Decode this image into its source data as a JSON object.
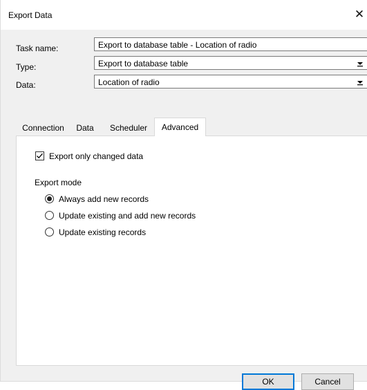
{
  "window": {
    "title": "Export Data",
    "close_glyph": "✕"
  },
  "form": {
    "task_name_label": "Task name:",
    "task_name_value": "Export to database table - Location of radio",
    "type_label": "Type:",
    "type_value": "Export to database table",
    "data_label": "Data:",
    "data_value": "Location of radio"
  },
  "tabs": [
    {
      "label": "Connection",
      "active": false
    },
    {
      "label": "Data",
      "active": false
    },
    {
      "label": "Scheduler",
      "active": false
    },
    {
      "label": "Advanced",
      "active": true
    }
  ],
  "advanced": {
    "export_changed_label": "Export only changed data",
    "export_changed_checked": true,
    "export_mode_label": "Export mode",
    "modes": [
      {
        "label": "Always add new records",
        "selected": true
      },
      {
        "label": "Update existing and add new records",
        "selected": false
      },
      {
        "label": "Update existing records",
        "selected": false
      }
    ]
  },
  "buttons": {
    "ok_label": "OK",
    "cancel_label": "Cancel"
  },
  "colors": {
    "accent": "#0078d7",
    "dialog_bg": "#f0f0f0"
  }
}
